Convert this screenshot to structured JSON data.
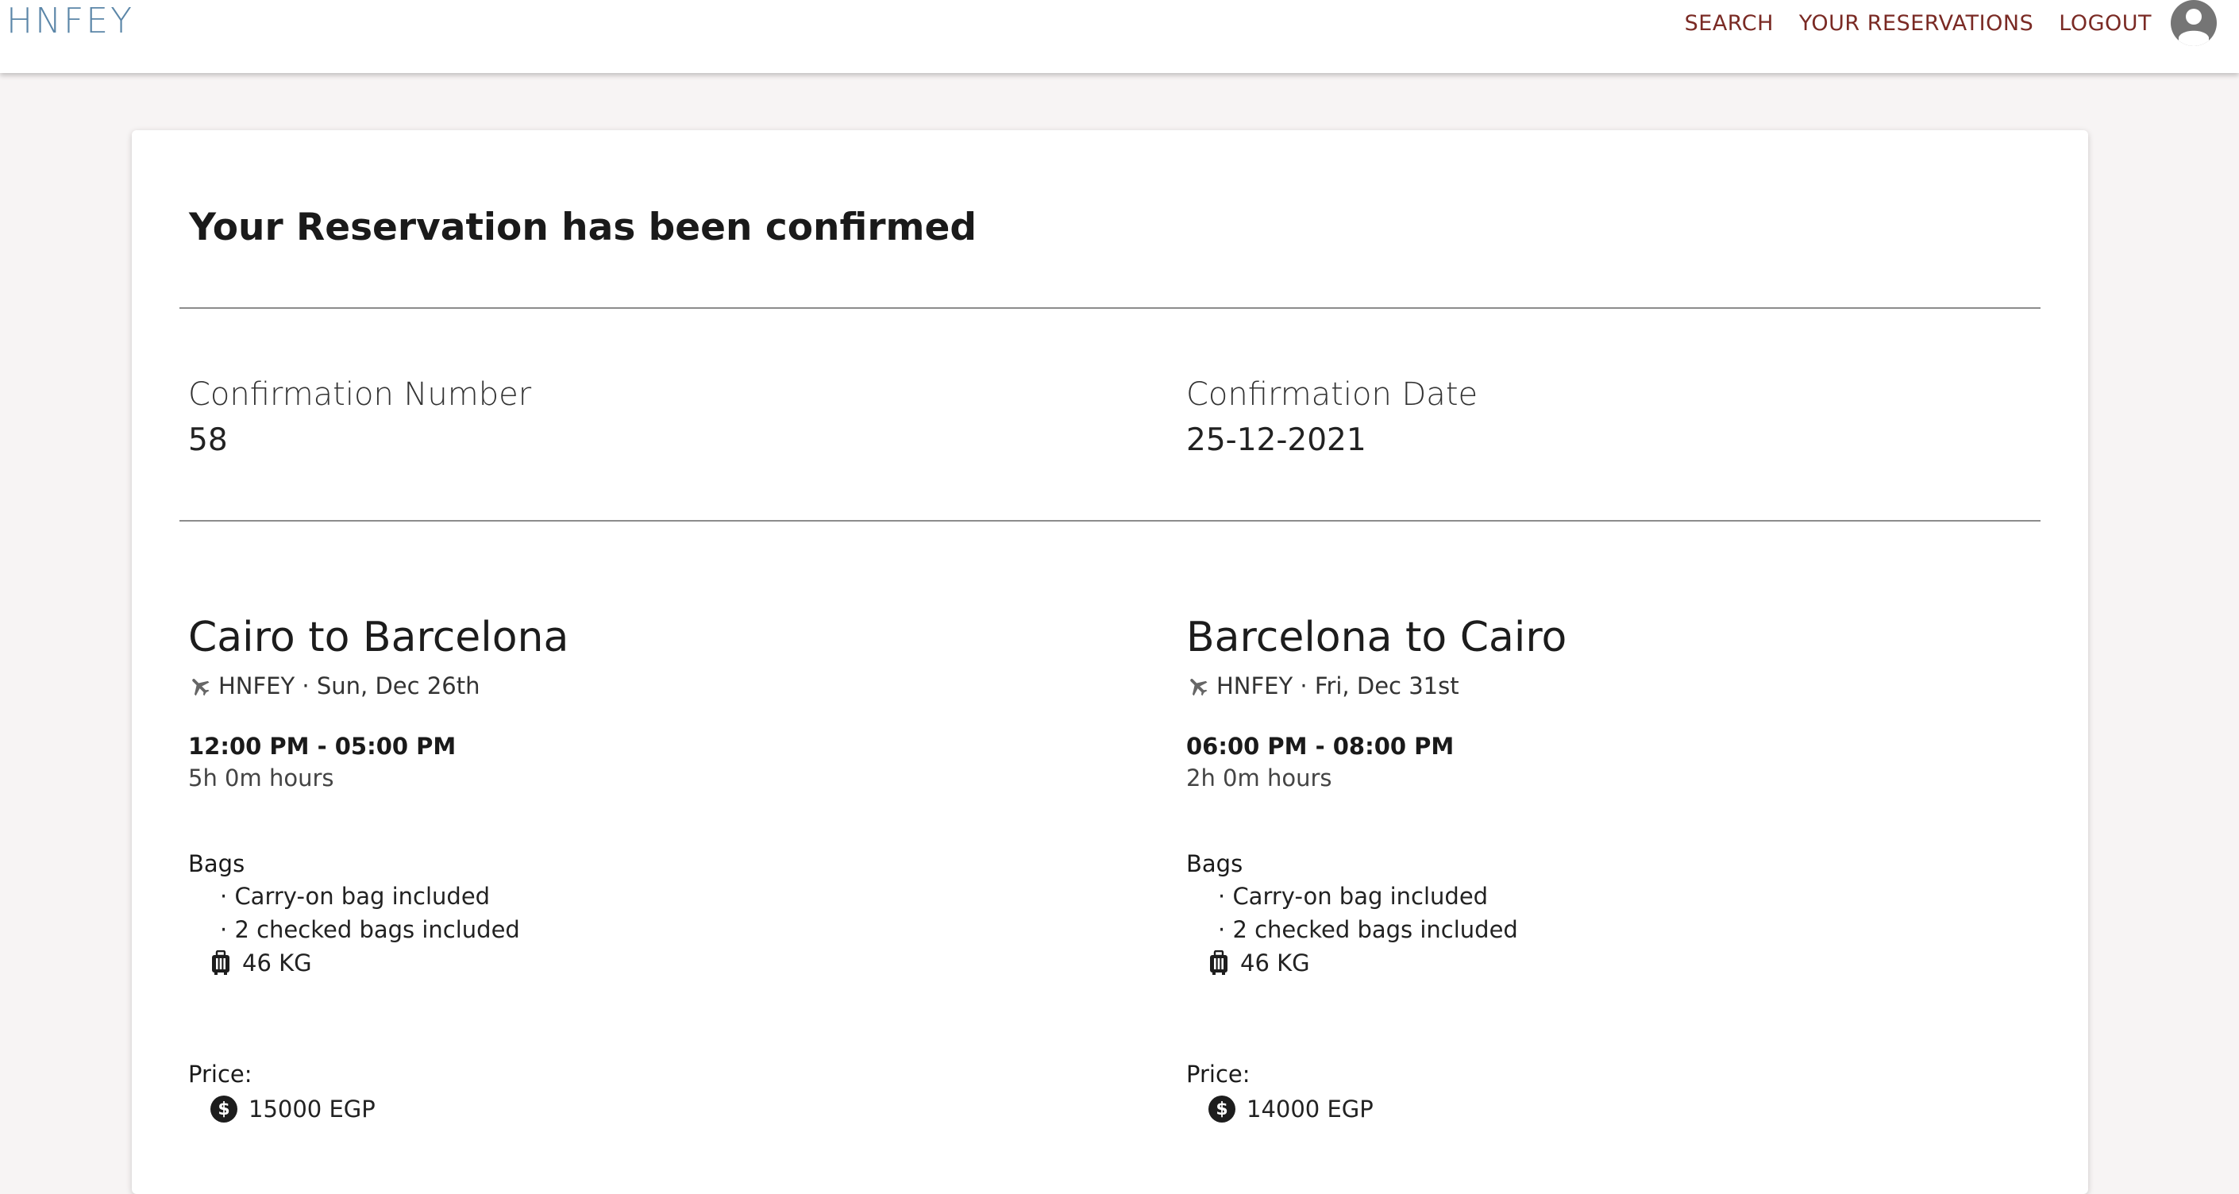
{
  "navbar": {
    "brand": "HNFEY",
    "links": [
      "SEARCH",
      "YOUR RESERVATIONS",
      "LOGOUT"
    ],
    "avatar_icon": "account-circle-icon"
  },
  "reservation": {
    "title": "Your Reservation has been confirmed",
    "confirmation_number_label": "Confirmation Number",
    "confirmation_number": "58",
    "confirmation_date_label": "Confirmation Date",
    "confirmation_date": "25-12-2021"
  },
  "legs": [
    {
      "route": "Cairo to Barcelona",
      "airline": "HNFEY",
      "date": "Sun, Dec 26th",
      "times": "12:00 PM - 05:00 PM",
      "duration": "5h 0m hours",
      "bags_label": "Bags",
      "bags": [
        "Carry-on bag included",
        "2 checked bags included"
      ],
      "weight": "46 KG",
      "price_label": "Price:",
      "price": "15000 EGP"
    },
    {
      "route": "Barcelona to Cairo",
      "airline": "HNFEY",
      "date": "Fri, Dec 31st",
      "times": "06:00 PM - 08:00 PM",
      "duration": "2h 0m hours",
      "bags_label": "Bags",
      "bags": [
        "Carry-on bag included",
        "2 checked bags included"
      ],
      "weight": "46 KG",
      "price_label": "Price:",
      "price": "14000 EGP"
    }
  ],
  "colors": {
    "brand": "#5b86a8",
    "nav_link": "#7a2a24",
    "background": "#f7f4f4"
  }
}
